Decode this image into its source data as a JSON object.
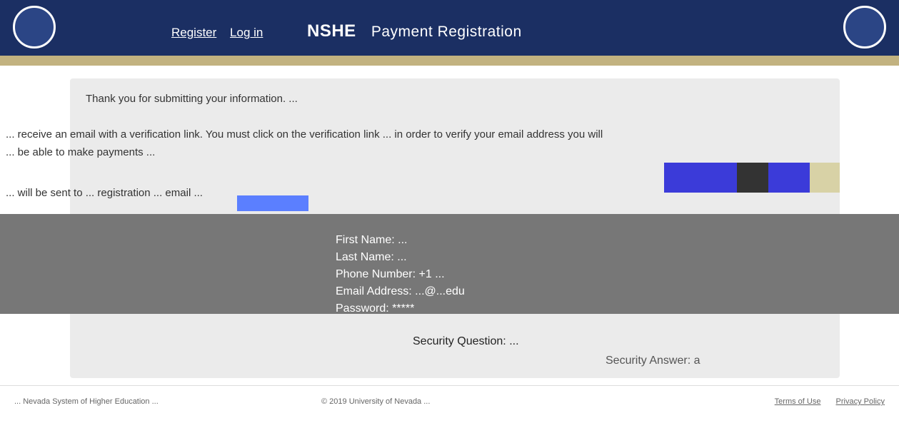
{
  "header": {
    "nav": [
      "Register",
      "Log in"
    ],
    "brand_short": "NSHE",
    "brand_title": "Payment Registration"
  },
  "content": {
    "message_lines": [
      "Thank you for submitting your information. ...",
      "... receive an email with a verification link. You must click on the verification link ... in order to verify your email address you will",
      "... be able to make payments ...",
      "... will be sent to ... registration ... email ..."
    ],
    "details": {
      "first_name_label": "First Name:",
      "first_name_value": "...",
      "last_name_label": "Last Name:",
      "last_name_value": "...",
      "phone_label": "Phone Number:",
      "phone_value": "+1 ...",
      "email_label": "Email Address:",
      "email_value": "...@...edu",
      "password_label": "Password:",
      "password_value": "*****",
      "security_question_label": "Security Question:",
      "security_question_value": "...",
      "security_answer_label": "Security Answer:",
      "security_answer_value": "a"
    }
  },
  "footer": {
    "left": "... Nevada System of Higher Education ...",
    "center": "© 2019 University of Nevada ...",
    "right": [
      "Terms of Use",
      "Privacy Policy"
    ]
  },
  "colors": {
    "header_bg": "#1b2f63",
    "gold": "#c2b280",
    "panel": "#777777"
  }
}
